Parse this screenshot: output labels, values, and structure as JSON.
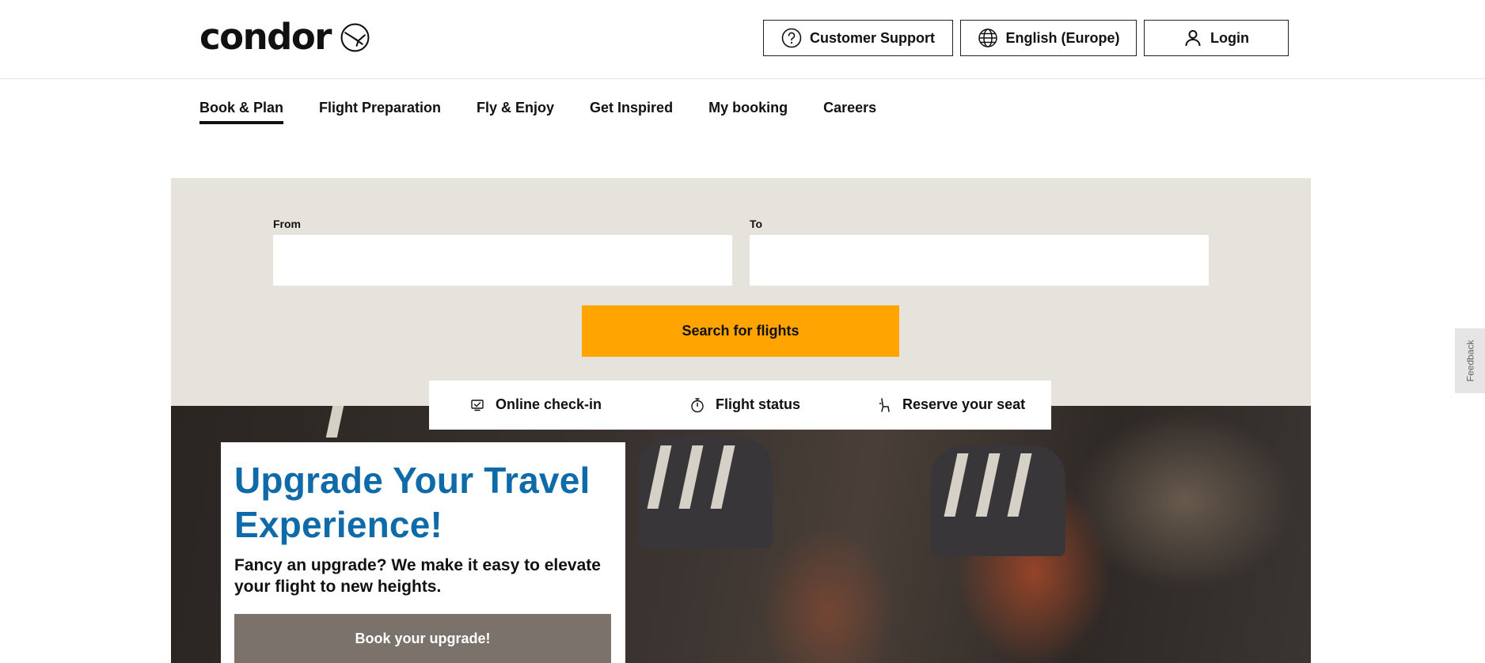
{
  "header": {
    "logo_text": "condor",
    "support_label": "Customer Support",
    "language_label": "English (Europe)",
    "login_label": "Login"
  },
  "nav": {
    "items": [
      {
        "label": "Book & Plan",
        "active": true
      },
      {
        "label": "Flight Preparation"
      },
      {
        "label": "Fly & Enjoy"
      },
      {
        "label": "Get Inspired"
      },
      {
        "label": "My booking"
      },
      {
        "label": "Careers"
      }
    ]
  },
  "search": {
    "from_label": "From",
    "from_value": "",
    "to_label": "To",
    "to_value": "",
    "button_label": "Search for flights",
    "button_color": "#ffa400",
    "panel_color": "#e6e3dc"
  },
  "quick_links": {
    "items": [
      {
        "label": "Online check-in",
        "icon": "laptop-check-icon"
      },
      {
        "label": "Flight status",
        "icon": "stopwatch-icon"
      },
      {
        "label": "Reserve your seat",
        "icon": "seat-icon"
      }
    ]
  },
  "promo": {
    "title": "Upgrade Your Travel Experience!",
    "text": "Fancy an upgrade? We make it easy to elevate your flight to new heights.",
    "button_label": "Book your upgrade!",
    "title_color": "#0e6aa8"
  },
  "feedback": {
    "label": "Feedback"
  }
}
